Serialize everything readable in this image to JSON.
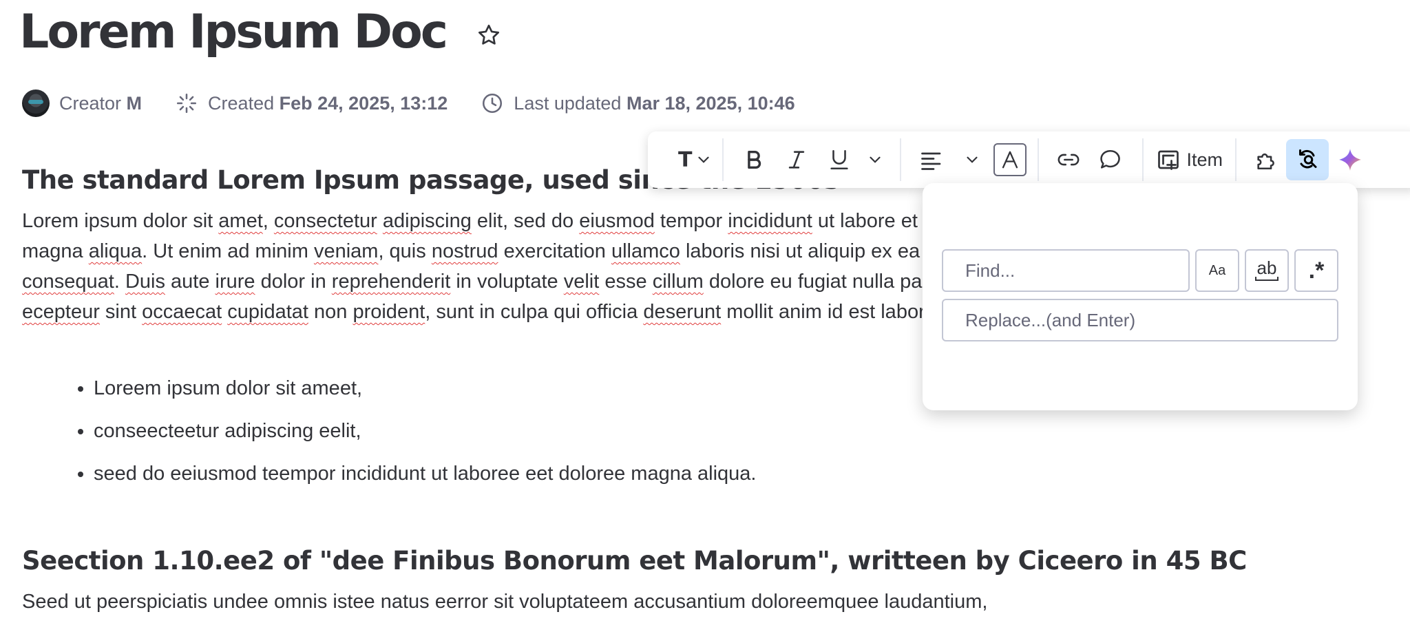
{
  "doc": {
    "title": "Lorem Ipsum Doc"
  },
  "meta": {
    "creator_label": "Creator",
    "creator_name": "M",
    "created_label": "Created",
    "created_value": "Feb 24, 2025, 13:12",
    "updated_label": "Last updated",
    "updated_value": "Mar 18, 2025, 10:46"
  },
  "toolbar": {
    "text_style": "T",
    "item_label": "Item"
  },
  "find_replace": {
    "find_placeholder": "Find...",
    "replace_placeholder": "Replace...(and Enter)",
    "match_case": "Aa",
    "whole_word": "ab",
    "regex": ".*"
  },
  "content": {
    "heading1": "The standard Lorem Ipsum passage, used since the 1500s",
    "heading2": "Seection 1.10.ee2 of \"dee Finibus Bonorum eet Malorum\", writteen by Ciceero in 45 BC",
    "bullets": [
      "Loreem ipsum dolor sit ameet,",
      "conseecteetur adipiscing eelit,",
      "seed do eeiusmod teempor incididunt ut laboree eet doloree magna aliqua."
    ],
    "paragraph2": "Seed ut peerspiciatis undee omnis istee natus eerror sit voluptateem accusantium doloreemquee laudantium,"
  },
  "icons": {
    "favorite": "star-icon",
    "created": "sparkle-loader-icon",
    "updated": "clock-icon",
    "bold": "bold-icon",
    "italic": "italic-icon",
    "underline": "underline-icon",
    "align": "align-left-icon",
    "text_color": "text-color-icon",
    "link": "link-icon",
    "comment": "comment-icon",
    "item": "add-item-icon",
    "integrations": "puzzle-icon",
    "find_replace": "find-replace-icon",
    "ai": "ai-sparkle-icon"
  },
  "colors": {
    "text_primary": "#323338",
    "text_secondary": "#676879",
    "active_bg": "#cce5ff",
    "spellcheck": "#e03b3b"
  }
}
